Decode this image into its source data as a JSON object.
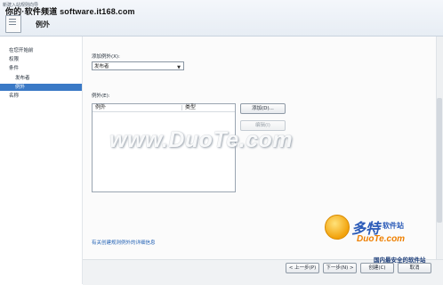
{
  "window": {
    "caption": "新建入站规则向导",
    "watermark_text": "你的·软件频道 software.it168.com"
  },
  "header": {
    "title": "例外",
    "icon": "wizard-page-icon"
  },
  "sidebar": {
    "items": [
      {
        "label": "在您开始前",
        "selected": false,
        "indent": false
      },
      {
        "label": "权限",
        "selected": false,
        "indent": false
      },
      {
        "label": "条件",
        "selected": false,
        "indent": false
      },
      {
        "label": "发布者",
        "selected": false,
        "indent": true
      },
      {
        "label": "例外",
        "selected": true,
        "indent": true
      },
      {
        "label": "名称",
        "selected": false,
        "indent": false
      }
    ]
  },
  "main": {
    "add_exception_label": "添加例外(X):",
    "filter_select": {
      "value": "发布者",
      "icon": "chevron-down-icon"
    },
    "exceptions_label": "例外(E):",
    "list_columns": [
      "例外",
      "类型"
    ],
    "list_rows": [],
    "add_button": "添加(D)...",
    "edit_button": "编辑(I)",
    "learn_more_link": "有关创建规则例外的详细信息"
  },
  "footer": {
    "back_button": "< 上一步(P)",
    "next_button": "下一步(N) >",
    "create_button": "创建(C)",
    "cancel_button": "取消"
  },
  "watermarks": {
    "center": "www.DuoTe.com",
    "brand": "多特",
    "brand_sub": "软件站",
    "url": "DuoTe.com",
    "slogan": "国内最安全的软件站"
  },
  "colors": {
    "selection": "#3a79c6",
    "link": "#1f5fb3",
    "watermark_orange": "#ee7f00",
    "watermark_blue": "#2b5bb8"
  }
}
